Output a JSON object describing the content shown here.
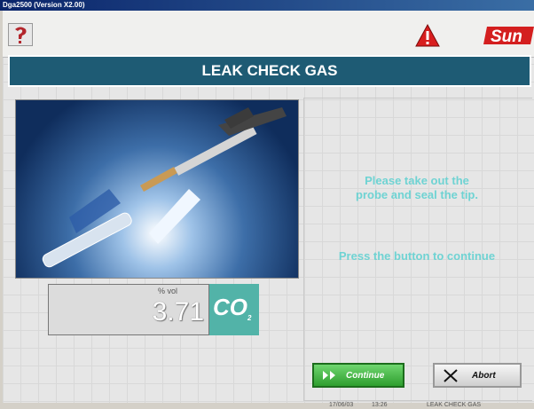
{
  "window": {
    "title": "Dga2500 (Version X2.00)"
  },
  "header": {
    "title": "LEAK CHECK GAS"
  },
  "toolbar": {
    "help_icon": "help-icon",
    "warning_icon": "warning-icon",
    "brand_text": "Sun"
  },
  "instructions": {
    "line1": "Please take out the",
    "line2": "probe and seal the tip.",
    "line3": "Press the button to continue"
  },
  "reading": {
    "unit": "% vol",
    "value": "3.71",
    "gas": "CO",
    "gas_sub": "2"
  },
  "buttons": {
    "continue": "Continue",
    "abort": "Abort"
  },
  "status": {
    "date": "17/06/03",
    "time": "13:26",
    "screen": "LEAK CHECK GAS"
  },
  "colors": {
    "band": "#1e5b74",
    "message": "#6fd3d3",
    "gas": "#52b3a8",
    "continue": "#2e9e2e"
  }
}
